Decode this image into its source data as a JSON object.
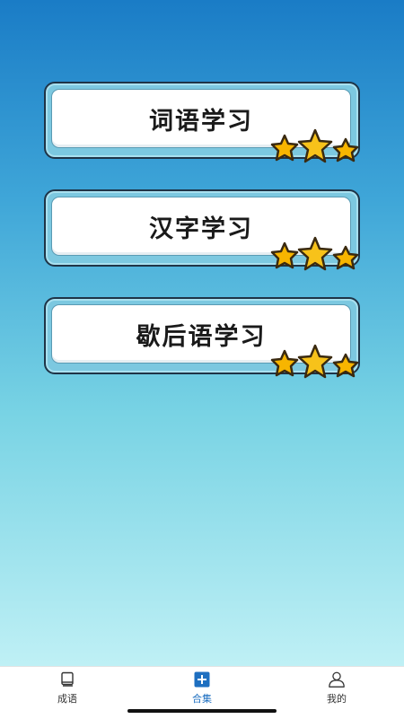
{
  "cards": [
    {
      "label": "词语学习"
    },
    {
      "label": "汉字学习"
    },
    {
      "label": "歇后语学习"
    }
  ],
  "tabs": [
    {
      "label": "成语",
      "icon": "book-icon"
    },
    {
      "label": "合集",
      "icon": "plus-square-icon"
    },
    {
      "label": "我的",
      "icon": "person-icon"
    }
  ],
  "colors": {
    "accent": "#1e6fc0",
    "star_fill": "#f7b500",
    "star_outline": "#3a2a10"
  }
}
